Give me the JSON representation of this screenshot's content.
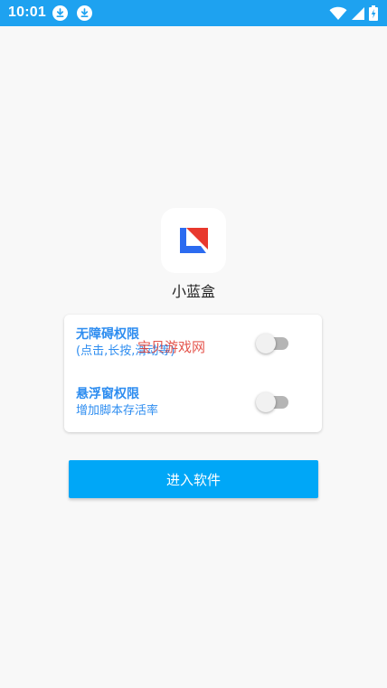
{
  "status_bar": {
    "time": "10:01",
    "left_icons": [
      "download-icon",
      "download-icon"
    ],
    "right_icons": [
      "wifi-icon",
      "signal-icon",
      "battery-charging-icon"
    ],
    "color": "#1ea2f0"
  },
  "app": {
    "name": "小蓝盒",
    "logo_colors": {
      "blue": "#2c6bf0",
      "red": "#e8382d"
    }
  },
  "permissions": [
    {
      "title": "无障碍权限",
      "description": "(点击,长按,滑动等)",
      "enabled": false
    },
    {
      "title": "悬浮窗权限",
      "description": "增加脚本存活率",
      "enabled": false
    }
  ],
  "watermark": "宝贝游戏网",
  "enter_button": {
    "label": "进入软件",
    "color": "#00a7f7"
  }
}
